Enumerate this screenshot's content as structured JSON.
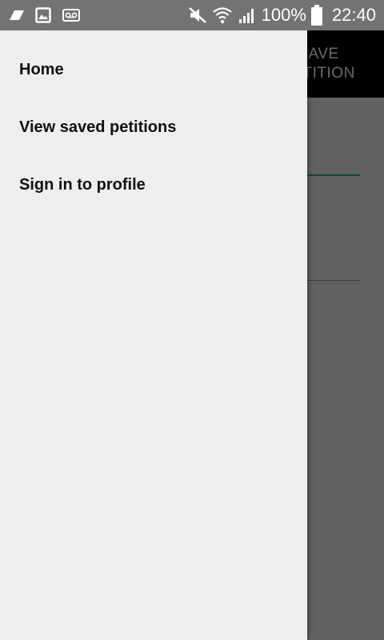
{
  "status_bar": {
    "battery_percent": "100%",
    "time": "22:40",
    "left_icons": [
      "signal-shape-icon",
      "image-icon",
      "voicemail-icon"
    ],
    "right_icons": [
      "mute-icon",
      "wifi-icon",
      "cell-signal-icon",
      "battery-icon"
    ]
  },
  "app": {
    "toolbar_action_label": "SAVE\nPETITION"
  },
  "drawer": {
    "items": [
      {
        "label": "Home"
      },
      {
        "label": "View saved petitions"
      },
      {
        "label": "Sign in to profile"
      }
    ]
  },
  "colors": {
    "status_bar": "#737373",
    "drawer_bg": "#eeeeee",
    "scrim": "#616161",
    "toolbar": "#000000",
    "accent_underline": "#0e4a3f"
  }
}
